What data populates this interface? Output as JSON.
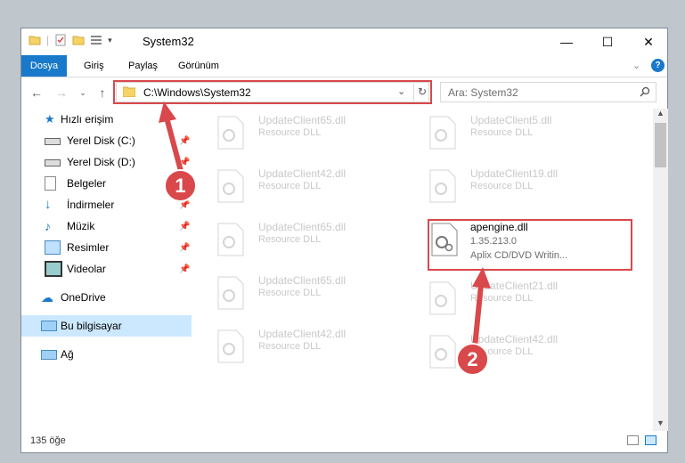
{
  "window": {
    "title": "System32",
    "controls": {
      "minimize": "—",
      "maximize": "☐",
      "close": "✕"
    }
  },
  "ribbon": {
    "tabs": [
      {
        "label": "Dosya"
      },
      {
        "label": "Giriş"
      },
      {
        "label": "Paylaş"
      },
      {
        "label": "Görünüm"
      }
    ]
  },
  "navigation": {
    "address": "C:\\Windows\\System32",
    "search_placeholder": "Ara: System32"
  },
  "sidebar": {
    "items": [
      {
        "label": "Hızlı erişim",
        "icon": "star-icon",
        "pinned": false
      },
      {
        "label": "Yerel Disk (C:)",
        "icon": "drive-icon",
        "pinned": true
      },
      {
        "label": "Yerel Disk (D:)",
        "icon": "drive-icon",
        "pinned": true
      },
      {
        "label": "Belgeler",
        "icon": "documents-icon",
        "pinned": true
      },
      {
        "label": "İndirmeler",
        "icon": "download-icon",
        "pinned": true
      },
      {
        "label": "Müzik",
        "icon": "music-icon",
        "pinned": true
      },
      {
        "label": "Resimler",
        "icon": "pictures-icon",
        "pinned": true
      },
      {
        "label": "Videolar",
        "icon": "video-icon",
        "pinned": true
      },
      {
        "label": "OneDrive",
        "icon": "cloud-icon",
        "pinned": false
      },
      {
        "label": "Bu bilgisayar",
        "icon": "computer-icon",
        "pinned": false
      },
      {
        "label": "Ağ",
        "icon": "network-icon",
        "pinned": false
      }
    ]
  },
  "files": [
    {
      "name": "UpdateClient65.dll",
      "desc": "Resource DLL"
    },
    {
      "name": "UpdateClient5.dll",
      "desc": "Resource DLL"
    },
    {
      "name": "UpdateClient42.dll",
      "desc": "Resource DLL"
    },
    {
      "name": "UpdateClient19.dll",
      "desc": "Resource DLL"
    },
    {
      "name": "UpdateClient65.dll",
      "desc": "Resource DLL"
    },
    {
      "name": "UpdateClient65.dll",
      "desc": "Resource DLL"
    },
    {
      "name": "UpdateClient21.dll",
      "desc": "Resource DLL"
    },
    {
      "name": "UpdateClient42.dll",
      "desc": "Resource DLL"
    },
    {
      "name": "UpdateClient42.dll",
      "desc": "Resource DLL"
    }
  ],
  "highlighted_file": {
    "name": "apengine.dll",
    "version": "1.35.213.0",
    "desc": "Aplix CD/DVD Writin..."
  },
  "status": {
    "count": "135 öğe"
  },
  "badges": {
    "one": "1",
    "two": "2"
  },
  "colors": {
    "accent": "#1979ca",
    "highlight": "#d9484b"
  }
}
